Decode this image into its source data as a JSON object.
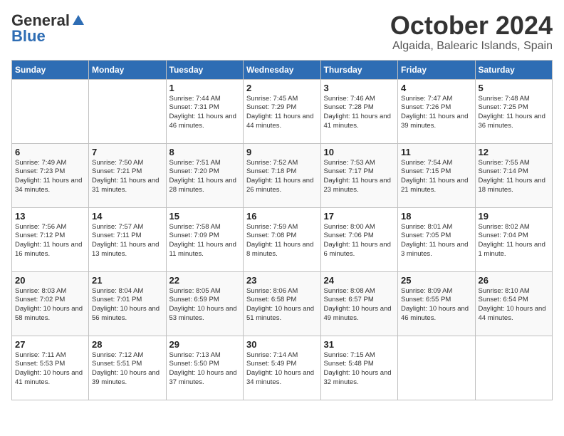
{
  "header": {
    "logo_general": "General",
    "logo_blue": "Blue",
    "month": "October 2024",
    "location": "Algaida, Balearic Islands, Spain"
  },
  "days_of_week": [
    "Sunday",
    "Monday",
    "Tuesday",
    "Wednesday",
    "Thursday",
    "Friday",
    "Saturday"
  ],
  "weeks": [
    [
      {
        "day": "",
        "empty": true
      },
      {
        "day": "",
        "empty": true
      },
      {
        "day": "1",
        "sunrise": "7:44 AM",
        "sunset": "7:31 PM",
        "daylight": "11 hours and 46 minutes."
      },
      {
        "day": "2",
        "sunrise": "7:45 AM",
        "sunset": "7:29 PM",
        "daylight": "11 hours and 44 minutes."
      },
      {
        "day": "3",
        "sunrise": "7:46 AM",
        "sunset": "7:28 PM",
        "daylight": "11 hours and 41 minutes."
      },
      {
        "day": "4",
        "sunrise": "7:47 AM",
        "sunset": "7:26 PM",
        "daylight": "11 hours and 39 minutes."
      },
      {
        "day": "5",
        "sunrise": "7:48 AM",
        "sunset": "7:25 PM",
        "daylight": "11 hours and 36 minutes."
      }
    ],
    [
      {
        "day": "6",
        "sunrise": "7:49 AM",
        "sunset": "7:23 PM",
        "daylight": "11 hours and 34 minutes."
      },
      {
        "day": "7",
        "sunrise": "7:50 AM",
        "sunset": "7:21 PM",
        "daylight": "11 hours and 31 minutes."
      },
      {
        "day": "8",
        "sunrise": "7:51 AM",
        "sunset": "7:20 PM",
        "daylight": "11 hours and 28 minutes."
      },
      {
        "day": "9",
        "sunrise": "7:52 AM",
        "sunset": "7:18 PM",
        "daylight": "11 hours and 26 minutes."
      },
      {
        "day": "10",
        "sunrise": "7:53 AM",
        "sunset": "7:17 PM",
        "daylight": "11 hours and 23 minutes."
      },
      {
        "day": "11",
        "sunrise": "7:54 AM",
        "sunset": "7:15 PM",
        "daylight": "11 hours and 21 minutes."
      },
      {
        "day": "12",
        "sunrise": "7:55 AM",
        "sunset": "7:14 PM",
        "daylight": "11 hours and 18 minutes."
      }
    ],
    [
      {
        "day": "13",
        "sunrise": "7:56 AM",
        "sunset": "7:12 PM",
        "daylight": "11 hours and 16 minutes."
      },
      {
        "day": "14",
        "sunrise": "7:57 AM",
        "sunset": "7:11 PM",
        "daylight": "11 hours and 13 minutes."
      },
      {
        "day": "15",
        "sunrise": "7:58 AM",
        "sunset": "7:09 PM",
        "daylight": "11 hours and 11 minutes."
      },
      {
        "day": "16",
        "sunrise": "7:59 AM",
        "sunset": "7:08 PM",
        "daylight": "11 hours and 8 minutes."
      },
      {
        "day": "17",
        "sunrise": "8:00 AM",
        "sunset": "7:06 PM",
        "daylight": "11 hours and 6 minutes."
      },
      {
        "day": "18",
        "sunrise": "8:01 AM",
        "sunset": "7:05 PM",
        "daylight": "11 hours and 3 minutes."
      },
      {
        "day": "19",
        "sunrise": "8:02 AM",
        "sunset": "7:04 PM",
        "daylight": "11 hours and 1 minute."
      }
    ],
    [
      {
        "day": "20",
        "sunrise": "8:03 AM",
        "sunset": "7:02 PM",
        "daylight": "10 hours and 58 minutes."
      },
      {
        "day": "21",
        "sunrise": "8:04 AM",
        "sunset": "7:01 PM",
        "daylight": "10 hours and 56 minutes."
      },
      {
        "day": "22",
        "sunrise": "8:05 AM",
        "sunset": "6:59 PM",
        "daylight": "10 hours and 53 minutes."
      },
      {
        "day": "23",
        "sunrise": "8:06 AM",
        "sunset": "6:58 PM",
        "daylight": "10 hours and 51 minutes."
      },
      {
        "day": "24",
        "sunrise": "8:08 AM",
        "sunset": "6:57 PM",
        "daylight": "10 hours and 49 minutes."
      },
      {
        "day": "25",
        "sunrise": "8:09 AM",
        "sunset": "6:55 PM",
        "daylight": "10 hours and 46 minutes."
      },
      {
        "day": "26",
        "sunrise": "8:10 AM",
        "sunset": "6:54 PM",
        "daylight": "10 hours and 44 minutes."
      }
    ],
    [
      {
        "day": "27",
        "sunrise": "7:11 AM",
        "sunset": "5:53 PM",
        "daylight": "10 hours and 41 minutes."
      },
      {
        "day": "28",
        "sunrise": "7:12 AM",
        "sunset": "5:51 PM",
        "daylight": "10 hours and 39 minutes."
      },
      {
        "day": "29",
        "sunrise": "7:13 AM",
        "sunset": "5:50 PM",
        "daylight": "10 hours and 37 minutes."
      },
      {
        "day": "30",
        "sunrise": "7:14 AM",
        "sunset": "5:49 PM",
        "daylight": "10 hours and 34 minutes."
      },
      {
        "day": "31",
        "sunrise": "7:15 AM",
        "sunset": "5:48 PM",
        "daylight": "10 hours and 32 minutes."
      },
      {
        "day": "",
        "empty": true
      },
      {
        "day": "",
        "empty": true
      }
    ]
  ],
  "labels": {
    "sunrise": "Sunrise:",
    "sunset": "Sunset:",
    "daylight": "Daylight:"
  }
}
